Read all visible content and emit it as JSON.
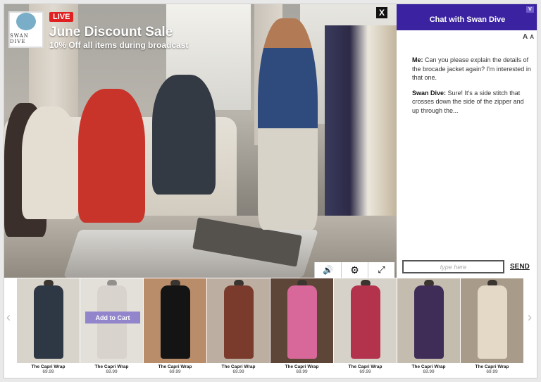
{
  "broadcast": {
    "live_badge": "LIVE",
    "title": "June Discount Sale",
    "subtitle": "10% Off all items during broadcast",
    "logo_text": "SWAN DIVE",
    "close_glyph": "X"
  },
  "video_controls": [
    {
      "name": "volume-icon",
      "glyph": "🔊"
    },
    {
      "name": "gear-icon",
      "glyph": "⚙"
    },
    {
      "name": "expand-icon",
      "glyph": "⤢"
    }
  ],
  "chat": {
    "title": "Chat with Swan Dive",
    "minimize_glyph": "V",
    "font_larger": "A",
    "font_smaller": "A",
    "messages": [
      {
        "sender": "Me:",
        "text": "Can you please explain the details of the brocade jacket again? I'm interested in that one."
      },
      {
        "sender": "Swan Dive:",
        "text": "Sure! It's a side stitch that crosses down the side of the zipper and up through the..."
      }
    ],
    "input_placeholder": "type here",
    "send_label": "SEND"
  },
  "carousel": {
    "prev_glyph": "‹",
    "next_glyph": "›",
    "add_to_cart_label": "Add to Cart",
    "products": [
      {
        "name": "The Capri Wrap",
        "price": "69.99",
        "color": "#2e3744",
        "bg": "#d9d4cb"
      },
      {
        "name": "The Capri Wrap",
        "price": "69.99",
        "color": "#b8b0a2",
        "bg": "#cdc6bb"
      },
      {
        "name": "The Capri Wrap",
        "price": "69.99",
        "color": "#141414",
        "bg": "#b98c6a"
      },
      {
        "name": "The Capri Wrap",
        "price": "69.99",
        "color": "#7a3b2c",
        "bg": "#bcaea0"
      },
      {
        "name": "The Capri Wrap",
        "price": "69.99",
        "color": "#d9689a",
        "bg": "#5d4638"
      },
      {
        "name": "The Capri Wrap",
        "price": "69.99",
        "color": "#b4334c",
        "bg": "#d7d2c9"
      },
      {
        "name": "The Capri Wrap",
        "price": "69.99",
        "color": "#3f2d58",
        "bg": "#c5bcb0"
      },
      {
        "name": "The Capri Wrap",
        "price": "69.99",
        "color": "#e3d9c6",
        "bg": "#a99b89"
      }
    ]
  }
}
